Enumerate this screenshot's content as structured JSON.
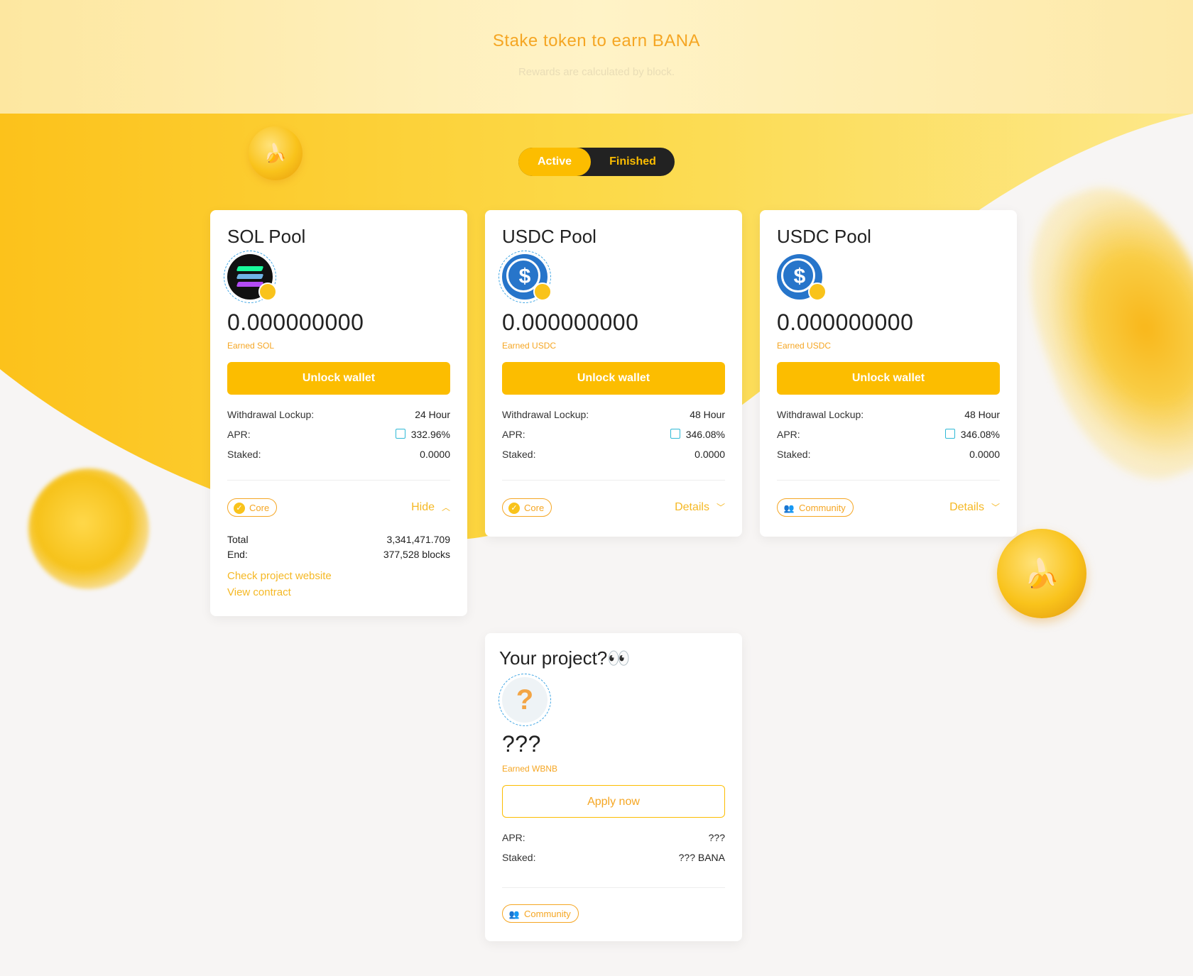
{
  "header": {
    "title": "Stake token to earn BANA",
    "subtitle": "Rewards are calculated by block."
  },
  "tabs": {
    "active": "Active",
    "finished": "Finished"
  },
  "pools": [
    {
      "title": "SOL Pool",
      "logo_icon": "sol-token-icon",
      "amount": "0.000000000",
      "earned": "Earned SOL",
      "button": "Unlock wallet",
      "withdrawal_label": "Withdrawal Lockup:",
      "withdrawal_value": "24 Hour",
      "apr_label": "APR:",
      "apr_value": "332.96%",
      "staked_label": "Staked:",
      "staked_value": "0.0000",
      "tag": "Core",
      "toggle": "Hide",
      "total_label": "Total",
      "total_value": "3,341,471.709",
      "end_label": "End:",
      "end_value": "377,528 blocks",
      "website_link": "Check project website",
      "contract_link": "View contract"
    },
    {
      "title": "USDC Pool",
      "logo_icon": "usdc-token-icon",
      "amount": "0.000000000",
      "earned": "Earned USDC",
      "button": "Unlock wallet",
      "withdrawal_label": "Withdrawal Lockup:",
      "withdrawal_value": "48 Hour",
      "apr_label": "APR:",
      "apr_value": "346.08%",
      "staked_label": "Staked:",
      "staked_value": "0.0000",
      "tag": "Core",
      "toggle": "Details"
    },
    {
      "title": "USDC Pool",
      "logo_icon": "usdc-token-icon",
      "amount": "0.000000000",
      "earned": "Earned USDC",
      "button": "Unlock wallet",
      "withdrawal_label": "Withdrawal Lockup:",
      "withdrawal_value": "48 Hour",
      "apr_label": "APR:",
      "apr_value": "346.08%",
      "staked_label": "Staked:",
      "staked_value": "0.0000",
      "tag": "Community",
      "toggle": "Details"
    }
  ],
  "project": {
    "title": "Your project?👀",
    "amount": "???",
    "earned": "Earned WBNB",
    "button": "Apply now",
    "apr_label": "APR:",
    "apr_value": "???",
    "staked_label": "Staked:",
    "staked_value": "??? BANA",
    "tag": "Community"
  },
  "colors": {
    "accent": "#fcbd00",
    "accent_text": "#f5a623",
    "dark": "#222222"
  }
}
